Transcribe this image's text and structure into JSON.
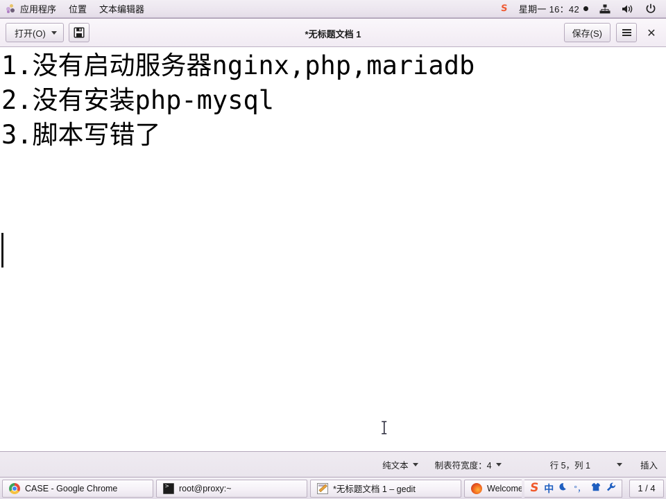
{
  "top_panel": {
    "apps_icon": "applications-icon",
    "menus": [
      {
        "label": "应用程序",
        "name": "panel-menu-applications"
      },
      {
        "label": "位置",
        "name": "panel-menu-places"
      },
      {
        "label": "文本编辑器",
        "name": "panel-menu-text-editor"
      }
    ],
    "tray": {
      "sogou_logo": "S",
      "clock": "星期一  16：42",
      "recording_indicator": "recording-dot",
      "network_icon": "network-icon",
      "volume_icon": "volume-icon",
      "power_icon": "power-icon"
    }
  },
  "headerbar": {
    "open_label": "打开(O)",
    "open_dropdown": "chevron-down-icon",
    "new_document_icon": "save-document-icon",
    "title": "*无标题文档 1",
    "save_label": "保存(S)",
    "menu_icon": "hamburger-menu-icon",
    "close_label": "✕"
  },
  "document": {
    "lines": [
      "1.没有启动服务器nginx,php,mariadb",
      "2.没有安装php-mysql",
      "3.脚本写错了",
      "",
      ""
    ],
    "caret_line": 5,
    "caret_column": 1
  },
  "statusbar": {
    "syntax": "纯文本",
    "tab_width": "制表符宽度：4",
    "position": "行 5，列 1",
    "insert_mode": "插入"
  },
  "taskbar": {
    "items": [
      {
        "label": "CASE - Google Chrome",
        "icon": "chrome-icon",
        "name": "taskbar-item-chrome"
      },
      {
        "label": "root@proxy:~",
        "icon": "terminal-icon",
        "name": "taskbar-item-terminal"
      },
      {
        "label": "*无标题文档 1 – gedit",
        "icon": "gedit-icon",
        "name": "taskbar-item-gedit"
      },
      {
        "label": "Welcome",
        "icon": "firefox-icon",
        "name": "taskbar-item-firefox"
      }
    ],
    "tray": {
      "sogou_logo": "S",
      "language": "中",
      "moon_icon": "moon-icon",
      "punctuation": "°，",
      "skin_icon": "shirt-icon",
      "settings_icon": "wrench-icon"
    },
    "workspace": "1 / 4"
  },
  "colors": {
    "panel_bg": "#ece6ef",
    "headerbar_bg": "#f6f1f7",
    "document_bg": "#ffffff",
    "text": "#000000",
    "accent_orange": "#f05a2c",
    "accent_blue": "#1f5fc0"
  }
}
